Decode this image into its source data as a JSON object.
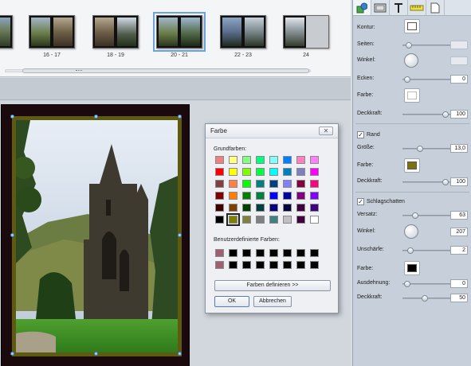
{
  "thumbnails": [
    {
      "label": "",
      "pages": [
        "p-a",
        "p-b"
      ]
    },
    {
      "label": "16 - 17",
      "pages": [
        "p-c",
        "p-d"
      ]
    },
    {
      "label": "18 - 19",
      "pages": [
        "p-d",
        "p-e"
      ]
    },
    {
      "label": "20 - 21",
      "pages": [
        "p-c",
        "p-i"
      ],
      "selected": true
    },
    {
      "label": "22 - 23",
      "pages": [
        "p-g",
        "p-h"
      ]
    },
    {
      "label": "24",
      "pages": [
        "p-f",
        "p-j"
      ]
    }
  ],
  "color_dialog": {
    "title": "Farbe",
    "close_label": "✕",
    "basic_label": "Grundfarben:",
    "custom_label": "Benutzerdefinierte Farben:",
    "define_button": "Farben definieren >>",
    "ok_button": "OK",
    "cancel_button": "Abbrechen",
    "basic_colors": [
      "#f08080",
      "#ffff80",
      "#80ff80",
      "#00ff80",
      "#80ffff",
      "#0080ff",
      "#ff80c0",
      "#ff80ff",
      "#ff0000",
      "#ffff00",
      "#80ff00",
      "#00ff40",
      "#00ffff",
      "#0080c0",
      "#8080c0",
      "#ff00ff",
      "#804040",
      "#ff8040",
      "#00ff00",
      "#008080",
      "#004080",
      "#8080ff",
      "#800040",
      "#ff0080",
      "#800000",
      "#ff8000",
      "#008000",
      "#008040",
      "#0000ff",
      "#0000a0",
      "#800080",
      "#8000ff",
      "#400000",
      "#804000",
      "#004000",
      "#004040",
      "#000080",
      "#000040",
      "#400040",
      "#400080",
      "#000000",
      "#808000",
      "#808040",
      "#808080",
      "#408080",
      "#c0c0c0",
      "#400040",
      "#ffffff"
    ],
    "selected_index": 41,
    "custom_colors": [
      "#a06070",
      "#000000",
      "#000000",
      "#000000",
      "#000000",
      "#000000",
      "#000000",
      "#000000",
      "#a06070",
      "#000000",
      "#000000",
      "#000000",
      "#000000",
      "#000000",
      "#000000",
      "#000000"
    ]
  },
  "panel": {
    "tabs": [
      "shapes-icon",
      "frame-icon",
      "text-icon",
      "ruler-icon",
      "page-icon"
    ],
    "kontur_label": "Kontur:",
    "seiten_label": "Seiten:",
    "winkel_label": "Winkel:",
    "ecken_label": "Ecken:",
    "ecken_value": "0",
    "farbe_label": "Farbe:",
    "deckkraft_label": "Deckkraft:",
    "deckkraft1_value": "100",
    "rand_label": "Rand",
    "groesse_label": "Größe:",
    "groesse_value": "13,0",
    "rand_color": "#7a7210",
    "deckkraft2_value": "100",
    "schatten_label": "Schlagschatten",
    "versatz_label": "Versatz:",
    "versatz_value": "63",
    "schatten_winkel_value": "207",
    "unschaerfe_label": "Unschärfe:",
    "unschaerfe_value": "2",
    "schatten_color": "#000000",
    "ausdehnung_label": "Ausdehnung:",
    "ausdehnung_value": "0",
    "deckkraft3_value": "50"
  }
}
